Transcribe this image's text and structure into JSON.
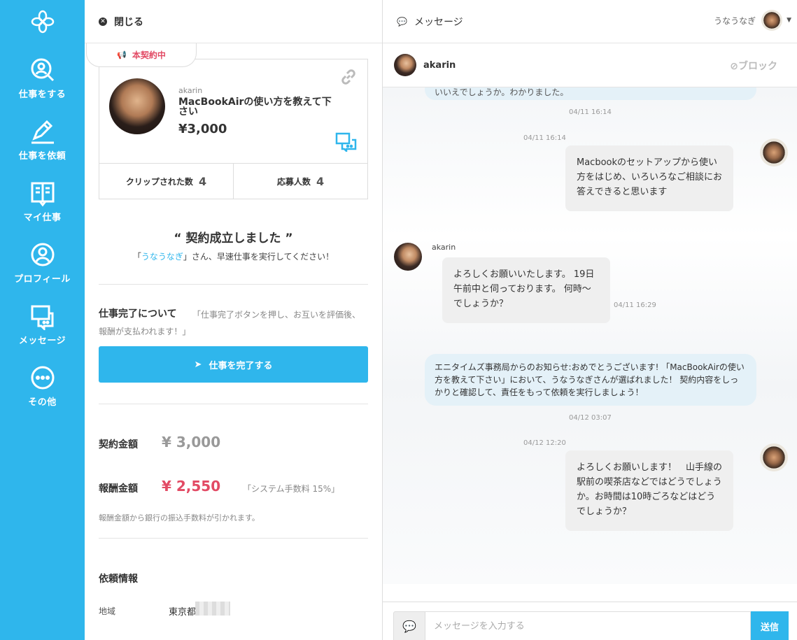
{
  "sidebar": {
    "items": [
      {
        "label": "仕事をする",
        "icon": "search-person-icon"
      },
      {
        "label": "仕事を依頼",
        "icon": "pencil-icon"
      },
      {
        "label": "マイ仕事",
        "icon": "book-icon"
      },
      {
        "label": "プロフィール",
        "icon": "person-icon"
      },
      {
        "label": "メッセージ",
        "icon": "chat-icon"
      },
      {
        "label": "その他",
        "icon": "more-icon"
      }
    ]
  },
  "panel": {
    "close_label": "閉じる",
    "status_tab": "本契約中",
    "job": {
      "user": "akarin",
      "title": "MacBookAirの使い方を教えて下さい",
      "price": "¥3,000"
    },
    "stats": {
      "clip_label": "クリップされた数",
      "clip_count": "4",
      "applicant_label": "応募人数",
      "applicant_count": "4"
    },
    "contract": {
      "title": "“ 契約成立しました ”",
      "msg_prefix": "「",
      "msg_user": "うなうなぎ",
      "msg_suffix": "」さん、早速仕事を実行してください！"
    },
    "completion": {
      "heading": "仕事完了について",
      "note": "「仕事完了ボタンを押し、お互いを評価後、報酬が支払われます！」",
      "button": "仕事を完了する"
    },
    "amounts": {
      "contract_label": "契約金額",
      "contract_value": "¥ 3,000",
      "reward_label": "報酬金額",
      "reward_value": "¥ 2,550",
      "fee_note": "「システム手数料 15%」",
      "bank_note": "報酬金額から銀行の振込手数料が引かれます。"
    },
    "info": {
      "heading": "依頼情報",
      "region_label": "地域",
      "region_value": "東京都"
    }
  },
  "messages": {
    "header_title": "メッセージ",
    "current_user": "うなうなぎ",
    "partner_name": "akarin",
    "block_label": "⊘ブロック",
    "top_cut_text": "いいえでしょうか。わかりました。",
    "items": [
      {
        "ts1": "04/11 16:14"
      },
      {
        "ts": "04/11 16:14",
        "text": "Macbookのセットアップから使い方をはじめ、いろいろなご相談にお答えできると思います"
      },
      {
        "sender": "akarin",
        "text": "よろしくお願いいたします。 19日午前中と伺っております。 何時～でしょうか？",
        "ts": "04/11 16:29"
      },
      {
        "text": "エニタイムズ事務局からのお知らせ:おめでとうございます! 「MacBookAirの使い方を教えて下さい」において、うなうなぎさんが選ばれました！ 契約内容をしっかりと確認して、責任をもって依頼を実行しましょう！",
        "ts": "04/12 03:07"
      },
      {
        "ts": "04/12 12:20",
        "text": "よろしくお願いします！　山手線の駅前の喫茶店などではどうでしょうか。お時間は10時ごろなどはどうでしょうか？"
      }
    ],
    "input_placeholder": "メッセージを入力する",
    "send_label": "送信"
  },
  "colors": {
    "accent": "#2fb6ec",
    "danger": "#e24a64"
  }
}
